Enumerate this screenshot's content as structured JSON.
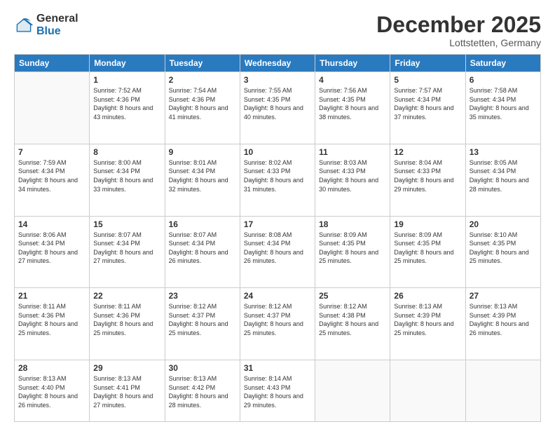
{
  "logo": {
    "general": "General",
    "blue": "Blue"
  },
  "title": "December 2025",
  "location": "Lottstetten, Germany",
  "weekdays": [
    "Sunday",
    "Monday",
    "Tuesday",
    "Wednesday",
    "Thursday",
    "Friday",
    "Saturday"
  ],
  "weeks": [
    [
      {
        "day": "",
        "sunrise": "",
        "sunset": "",
        "daylight": ""
      },
      {
        "day": "1",
        "sunrise": "Sunrise: 7:52 AM",
        "sunset": "Sunset: 4:36 PM",
        "daylight": "Daylight: 8 hours and 43 minutes."
      },
      {
        "day": "2",
        "sunrise": "Sunrise: 7:54 AM",
        "sunset": "Sunset: 4:36 PM",
        "daylight": "Daylight: 8 hours and 41 minutes."
      },
      {
        "day": "3",
        "sunrise": "Sunrise: 7:55 AM",
        "sunset": "Sunset: 4:35 PM",
        "daylight": "Daylight: 8 hours and 40 minutes."
      },
      {
        "day": "4",
        "sunrise": "Sunrise: 7:56 AM",
        "sunset": "Sunset: 4:35 PM",
        "daylight": "Daylight: 8 hours and 38 minutes."
      },
      {
        "day": "5",
        "sunrise": "Sunrise: 7:57 AM",
        "sunset": "Sunset: 4:34 PM",
        "daylight": "Daylight: 8 hours and 37 minutes."
      },
      {
        "day": "6",
        "sunrise": "Sunrise: 7:58 AM",
        "sunset": "Sunset: 4:34 PM",
        "daylight": "Daylight: 8 hours and 35 minutes."
      }
    ],
    [
      {
        "day": "7",
        "sunrise": "Sunrise: 7:59 AM",
        "sunset": "Sunset: 4:34 PM",
        "daylight": "Daylight: 8 hours and 34 minutes."
      },
      {
        "day": "8",
        "sunrise": "Sunrise: 8:00 AM",
        "sunset": "Sunset: 4:34 PM",
        "daylight": "Daylight: 8 hours and 33 minutes."
      },
      {
        "day": "9",
        "sunrise": "Sunrise: 8:01 AM",
        "sunset": "Sunset: 4:34 PM",
        "daylight": "Daylight: 8 hours and 32 minutes."
      },
      {
        "day": "10",
        "sunrise": "Sunrise: 8:02 AM",
        "sunset": "Sunset: 4:33 PM",
        "daylight": "Daylight: 8 hours and 31 minutes."
      },
      {
        "day": "11",
        "sunrise": "Sunrise: 8:03 AM",
        "sunset": "Sunset: 4:33 PM",
        "daylight": "Daylight: 8 hours and 30 minutes."
      },
      {
        "day": "12",
        "sunrise": "Sunrise: 8:04 AM",
        "sunset": "Sunset: 4:33 PM",
        "daylight": "Daylight: 8 hours and 29 minutes."
      },
      {
        "day": "13",
        "sunrise": "Sunrise: 8:05 AM",
        "sunset": "Sunset: 4:34 PM",
        "daylight": "Daylight: 8 hours and 28 minutes."
      }
    ],
    [
      {
        "day": "14",
        "sunrise": "Sunrise: 8:06 AM",
        "sunset": "Sunset: 4:34 PM",
        "daylight": "Daylight: 8 hours and 27 minutes."
      },
      {
        "day": "15",
        "sunrise": "Sunrise: 8:07 AM",
        "sunset": "Sunset: 4:34 PM",
        "daylight": "Daylight: 8 hours and 27 minutes."
      },
      {
        "day": "16",
        "sunrise": "Sunrise: 8:07 AM",
        "sunset": "Sunset: 4:34 PM",
        "daylight": "Daylight: 8 hours and 26 minutes."
      },
      {
        "day": "17",
        "sunrise": "Sunrise: 8:08 AM",
        "sunset": "Sunset: 4:34 PM",
        "daylight": "Daylight: 8 hours and 26 minutes."
      },
      {
        "day": "18",
        "sunrise": "Sunrise: 8:09 AM",
        "sunset": "Sunset: 4:35 PM",
        "daylight": "Daylight: 8 hours and 25 minutes."
      },
      {
        "day": "19",
        "sunrise": "Sunrise: 8:09 AM",
        "sunset": "Sunset: 4:35 PM",
        "daylight": "Daylight: 8 hours and 25 minutes."
      },
      {
        "day": "20",
        "sunrise": "Sunrise: 8:10 AM",
        "sunset": "Sunset: 4:35 PM",
        "daylight": "Daylight: 8 hours and 25 minutes."
      }
    ],
    [
      {
        "day": "21",
        "sunrise": "Sunrise: 8:11 AM",
        "sunset": "Sunset: 4:36 PM",
        "daylight": "Daylight: 8 hours and 25 minutes."
      },
      {
        "day": "22",
        "sunrise": "Sunrise: 8:11 AM",
        "sunset": "Sunset: 4:36 PM",
        "daylight": "Daylight: 8 hours and 25 minutes."
      },
      {
        "day": "23",
        "sunrise": "Sunrise: 8:12 AM",
        "sunset": "Sunset: 4:37 PM",
        "daylight": "Daylight: 8 hours and 25 minutes."
      },
      {
        "day": "24",
        "sunrise": "Sunrise: 8:12 AM",
        "sunset": "Sunset: 4:37 PM",
        "daylight": "Daylight: 8 hours and 25 minutes."
      },
      {
        "day": "25",
        "sunrise": "Sunrise: 8:12 AM",
        "sunset": "Sunset: 4:38 PM",
        "daylight": "Daylight: 8 hours and 25 minutes."
      },
      {
        "day": "26",
        "sunrise": "Sunrise: 8:13 AM",
        "sunset": "Sunset: 4:39 PM",
        "daylight": "Daylight: 8 hours and 25 minutes."
      },
      {
        "day": "27",
        "sunrise": "Sunrise: 8:13 AM",
        "sunset": "Sunset: 4:39 PM",
        "daylight": "Daylight: 8 hours and 26 minutes."
      }
    ],
    [
      {
        "day": "28",
        "sunrise": "Sunrise: 8:13 AM",
        "sunset": "Sunset: 4:40 PM",
        "daylight": "Daylight: 8 hours and 26 minutes."
      },
      {
        "day": "29",
        "sunrise": "Sunrise: 8:13 AM",
        "sunset": "Sunset: 4:41 PM",
        "daylight": "Daylight: 8 hours and 27 minutes."
      },
      {
        "day": "30",
        "sunrise": "Sunrise: 8:13 AM",
        "sunset": "Sunset: 4:42 PM",
        "daylight": "Daylight: 8 hours and 28 minutes."
      },
      {
        "day": "31",
        "sunrise": "Sunrise: 8:14 AM",
        "sunset": "Sunset: 4:43 PM",
        "daylight": "Daylight: 8 hours and 29 minutes."
      },
      {
        "day": "",
        "sunrise": "",
        "sunset": "",
        "daylight": ""
      },
      {
        "day": "",
        "sunrise": "",
        "sunset": "",
        "daylight": ""
      },
      {
        "day": "",
        "sunrise": "",
        "sunset": "",
        "daylight": ""
      }
    ]
  ]
}
